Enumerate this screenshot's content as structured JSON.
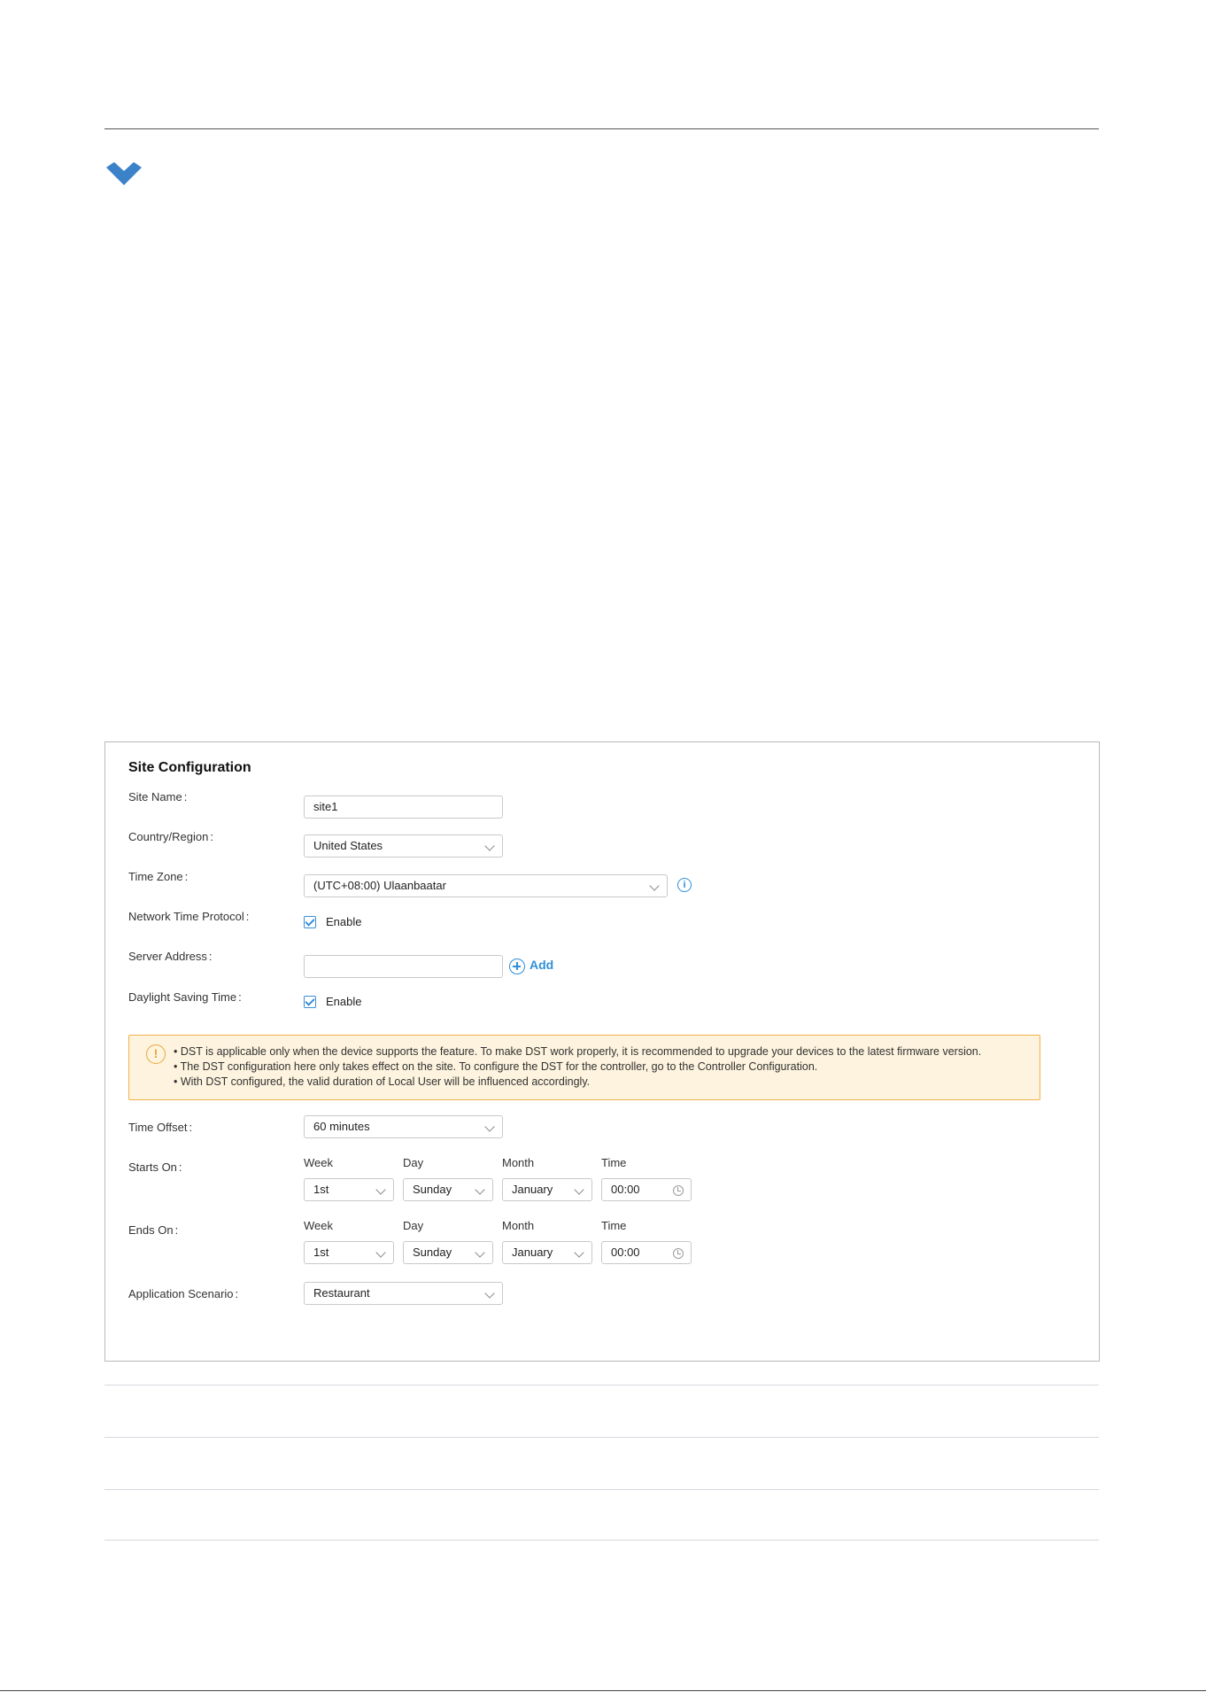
{
  "panel": {
    "title": "Site Configuration",
    "site_name": {
      "label": "Site Name",
      "value": "site1"
    },
    "country": {
      "label": "Country/Region",
      "value": "United States"
    },
    "time_zone": {
      "label": "Time Zone",
      "value": "(UTC+08:00) Ulaanbaatar",
      "info_icon": "info-icon"
    },
    "ntp": {
      "label": "Network Time Protocol",
      "checkbox_label": "Enable",
      "checked": true
    },
    "server_address": {
      "label": "Server Address",
      "value": "",
      "add_label": "Add"
    },
    "dst": {
      "label": "Daylight Saving Time",
      "checkbox_label": "Enable",
      "checked": true
    },
    "notice": {
      "icon": "warning-icon",
      "lines": [
        "• DST is applicable only when the device supports the feature. To make DST work properly, it is recommended to upgrade your devices to the latest firmware version.",
        "• The DST configuration here only takes effect on the site. To configure the DST for the controller, go to the Controller Configuration.",
        "• With DST configured, the valid duration of Local User will be influenced accordingly."
      ]
    },
    "time_offset": {
      "label": "Time Offset",
      "value": "60 minutes"
    },
    "columns": {
      "week": "Week",
      "day": "Day",
      "month": "Month",
      "time": "Time"
    },
    "starts_on": {
      "label": "Starts On",
      "week": "1st",
      "day": "Sunday",
      "month": "January",
      "time": "00:00"
    },
    "ends_on": {
      "label": "Ends On",
      "week": "1st",
      "day": "Sunday",
      "month": "January",
      "time": "00:00"
    },
    "scenario": {
      "label": "Application Scenario",
      "value": "Restaurant"
    }
  },
  "colors": {
    "accent": "#2f8fd8",
    "warning_bg": "#fdf3de",
    "warning_border": "#f0b24a"
  }
}
